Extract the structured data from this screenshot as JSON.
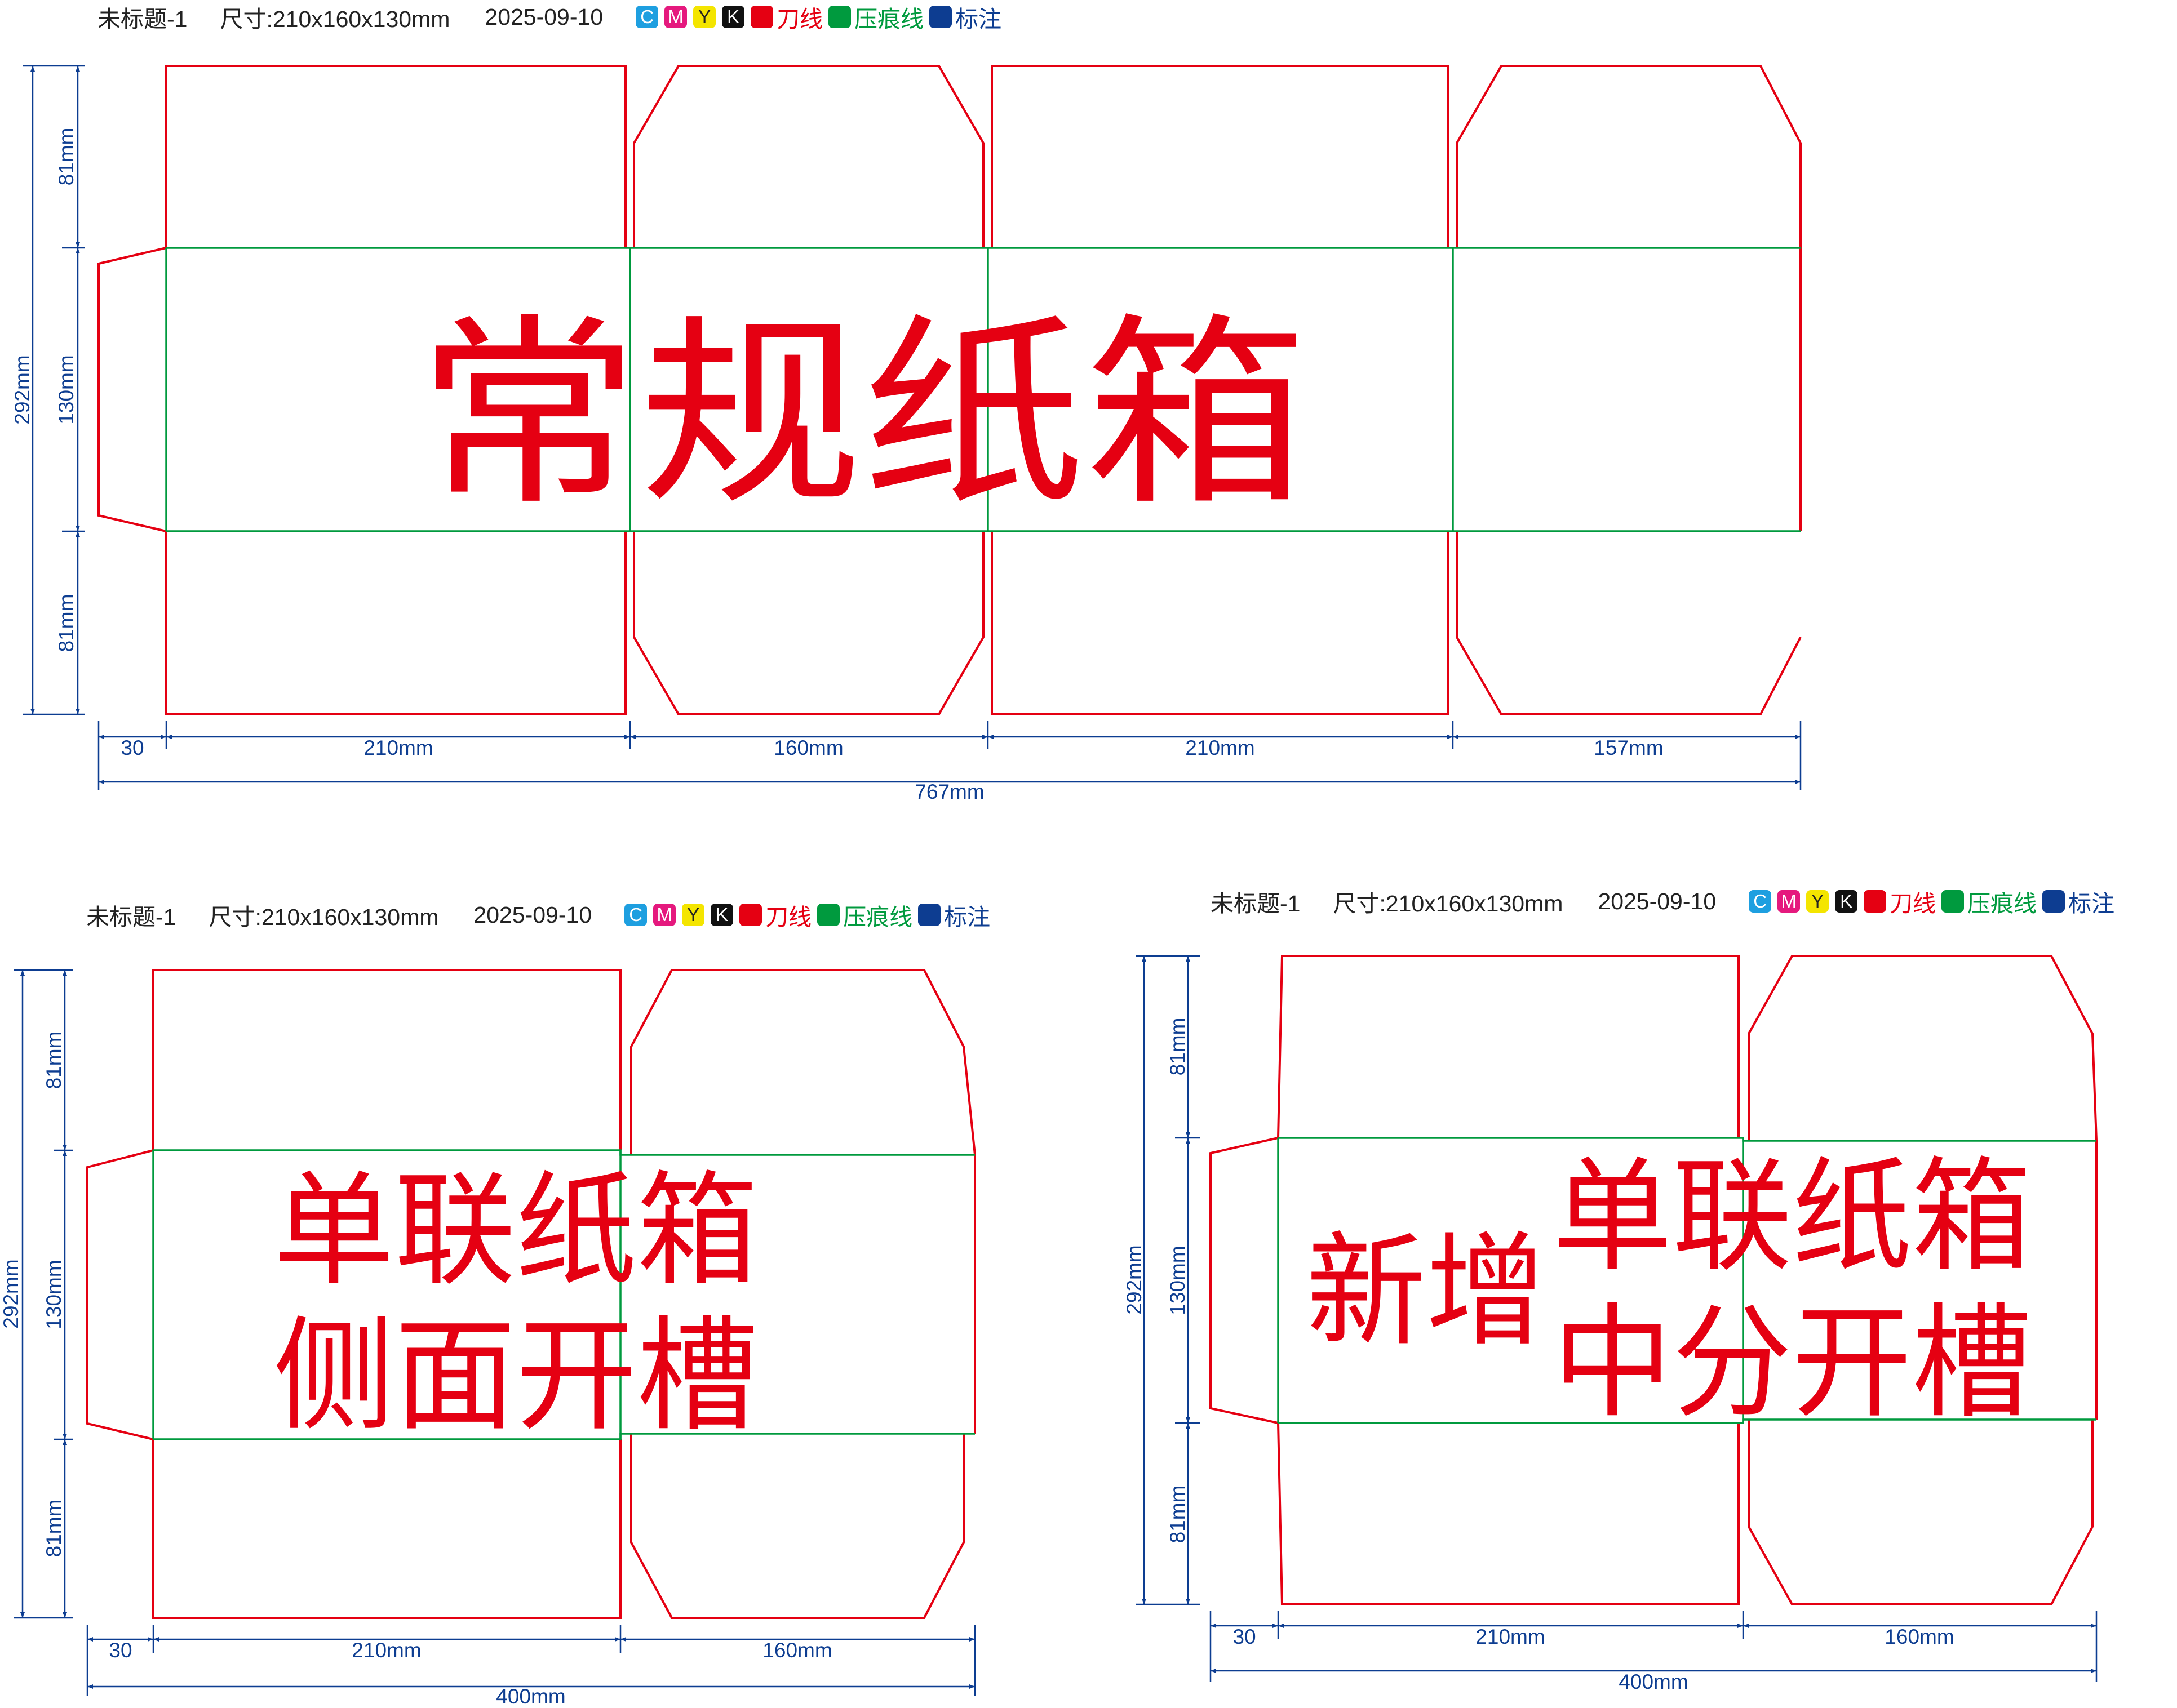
{
  "header": {
    "doc_name": "未标题-1",
    "size_label": "尺寸:210x160x130mm",
    "date": "2025-09-10",
    "swatches": [
      {
        "letter": "C",
        "color": "#1e9fe0"
      },
      {
        "letter": "M",
        "color": "#e5197e"
      },
      {
        "letter": "Y",
        "color": "#f4e500"
      },
      {
        "letter": "K",
        "color": "#111111"
      }
    ],
    "legend": [
      {
        "label": "刀线",
        "color": "#e50012"
      },
      {
        "label": "压痕线",
        "color": "#009a3e"
      },
      {
        "label": "标注",
        "color": "#0d3d91"
      }
    ]
  },
  "colors": {
    "cut": "#e50012",
    "crease": "#009a3e",
    "dimension": "#0d3d91"
  },
  "layouts": [
    {
      "id": "regular",
      "title": "常规纸箱",
      "title_lines": [
        "常规纸箱"
      ],
      "dims": {
        "total_height": "292mm",
        "flap_top": "81mm",
        "body_height": "130mm",
        "flap_bottom": "81mm",
        "glue": "30",
        "panels": [
          "210mm",
          "160mm",
          "210mm",
          "157mm"
        ],
        "total_width": "767mm"
      }
    },
    {
      "id": "single-side-slot",
      "title": "单联纸箱 侧面开槽",
      "title_lines": [
        "单联纸箱",
        "侧面开槽"
      ],
      "dims": {
        "total_height": "292mm",
        "flap_top": "81mm",
        "body_height": "130mm",
        "flap_bottom": "81mm",
        "glue": "30",
        "panels": [
          "210mm",
          "160mm"
        ],
        "total_width": "400mm"
      }
    },
    {
      "id": "single-center-slot",
      "title": "新增 单联纸箱 中分开槽",
      "prefix": "新增",
      "title_lines": [
        "单联纸箱",
        "中分开槽"
      ],
      "dims": {
        "total_height": "292mm",
        "flap_top": "81mm",
        "body_height": "130mm",
        "flap_bottom": "81mm",
        "glue": "30",
        "panels": [
          "210mm",
          "160mm"
        ],
        "total_width": "400mm"
      }
    }
  ]
}
